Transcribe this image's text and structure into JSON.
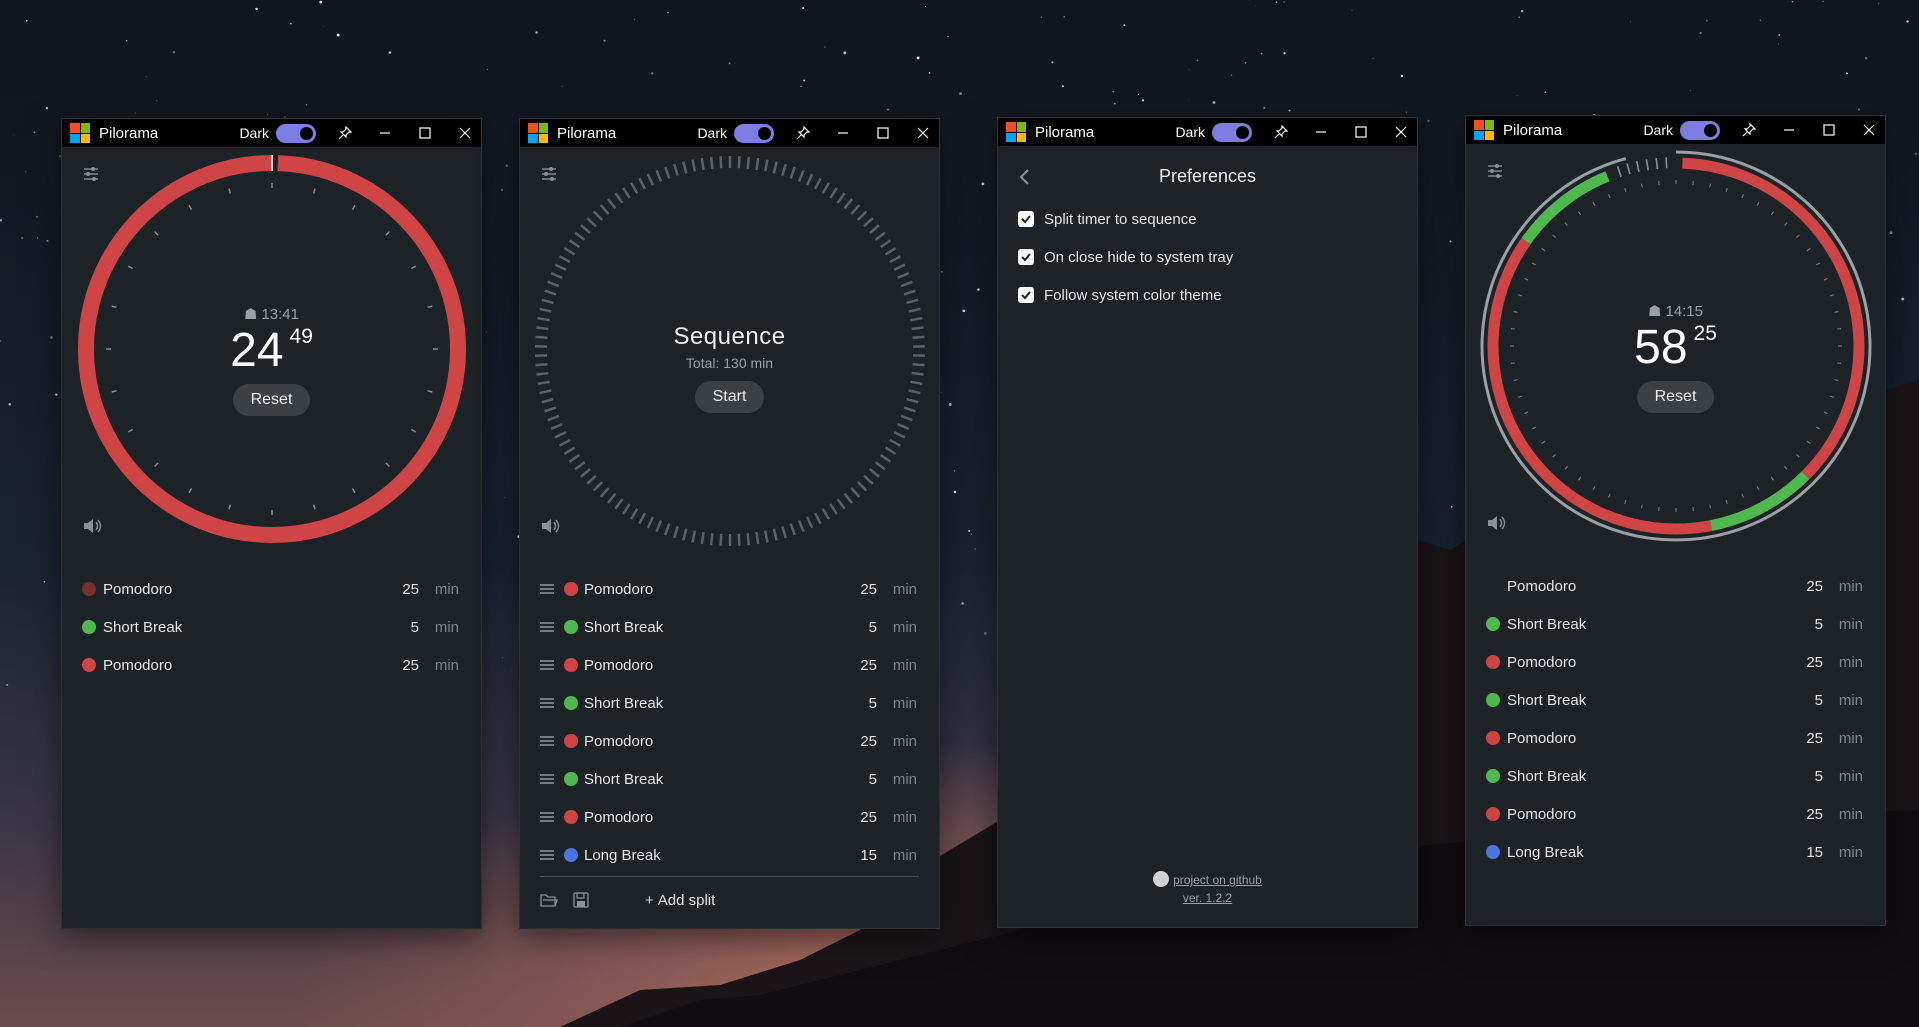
{
  "colors": {
    "red": "#cf4444",
    "green": "#4fb84f",
    "blue": "#4a74e0",
    "dark_red": "#7a3030",
    "toggle": "#7b7de0",
    "window_bg": "#1d2226"
  },
  "window1": {
    "title": "Pilorama",
    "dark_label": "Dark",
    "clock": "13:41",
    "timer_min": "24",
    "timer_sec": "49",
    "reset_label": "Reset",
    "remaining_fraction": 0.995,
    "list": [
      {
        "name": "Pomodoro",
        "value": "25",
        "unit": "min",
        "color": "#7a3030"
      },
      {
        "name": "Short Break",
        "value": "5",
        "unit": "min",
        "color": "#4fb84f"
      },
      {
        "name": "Pomodoro",
        "value": "25",
        "unit": "min",
        "color": "#cf4444"
      }
    ]
  },
  "window2": {
    "title": "Pilorama",
    "dark_label": "Dark",
    "sequence_title": "Sequence",
    "total_label": "Total: 130 min",
    "start_label": "Start",
    "add_split_label": "Add split",
    "list": [
      {
        "name": "Pomodoro",
        "value": "25",
        "unit": "min",
        "color": "#cf4444"
      },
      {
        "name": "Short Break",
        "value": "5",
        "unit": "min",
        "color": "#4fb84f"
      },
      {
        "name": "Pomodoro",
        "value": "25",
        "unit": "min",
        "color": "#cf4444"
      },
      {
        "name": "Short Break",
        "value": "5",
        "unit": "min",
        "color": "#4fb84f"
      },
      {
        "name": "Pomodoro",
        "value": "25",
        "unit": "min",
        "color": "#cf4444"
      },
      {
        "name": "Short Break",
        "value": "5",
        "unit": "min",
        "color": "#4fb84f"
      },
      {
        "name": "Pomodoro",
        "value": "25",
        "unit": "min",
        "color": "#cf4444"
      },
      {
        "name": "Long Break",
        "value": "15",
        "unit": "min",
        "color": "#4a74e0"
      }
    ]
  },
  "window3": {
    "title": "Pilorama",
    "dark_label": "Dark",
    "preferences_title": "Preferences",
    "options": [
      {
        "label": "Split timer to sequence",
        "checked": true
      },
      {
        "label": "On close hide to system tray",
        "checked": true
      },
      {
        "label": "Follow system color theme",
        "checked": true
      }
    ],
    "github_link": "project on github",
    "version": "ver. 1.2.2"
  },
  "window4": {
    "title": "Pilorama",
    "dark_label": "Dark",
    "clock": "14:15",
    "timer_min": "58",
    "timer_sec": "25",
    "reset_label": "Reset",
    "list": [
      {
        "name": "Pomodoro",
        "value": "25",
        "unit": "min",
        "color": ""
      },
      {
        "name": "Short Break",
        "value": "5",
        "unit": "min",
        "color": "#4fb84f"
      },
      {
        "name": "Pomodoro",
        "value": "25",
        "unit": "min",
        "color": "#cf4444"
      },
      {
        "name": "Short Break",
        "value": "5",
        "unit": "min",
        "color": "#4fb84f"
      },
      {
        "name": "Pomodoro",
        "value": "25",
        "unit": "min",
        "color": "#cf4444"
      },
      {
        "name": "Short Break",
        "value": "5",
        "unit": "min",
        "color": "#4fb84f"
      },
      {
        "name": "Pomodoro",
        "value": "25",
        "unit": "min",
        "color": "#cf4444"
      },
      {
        "name": "Long Break",
        "value": "15",
        "unit": "min",
        "color": "#4a74e0"
      }
    ]
  }
}
